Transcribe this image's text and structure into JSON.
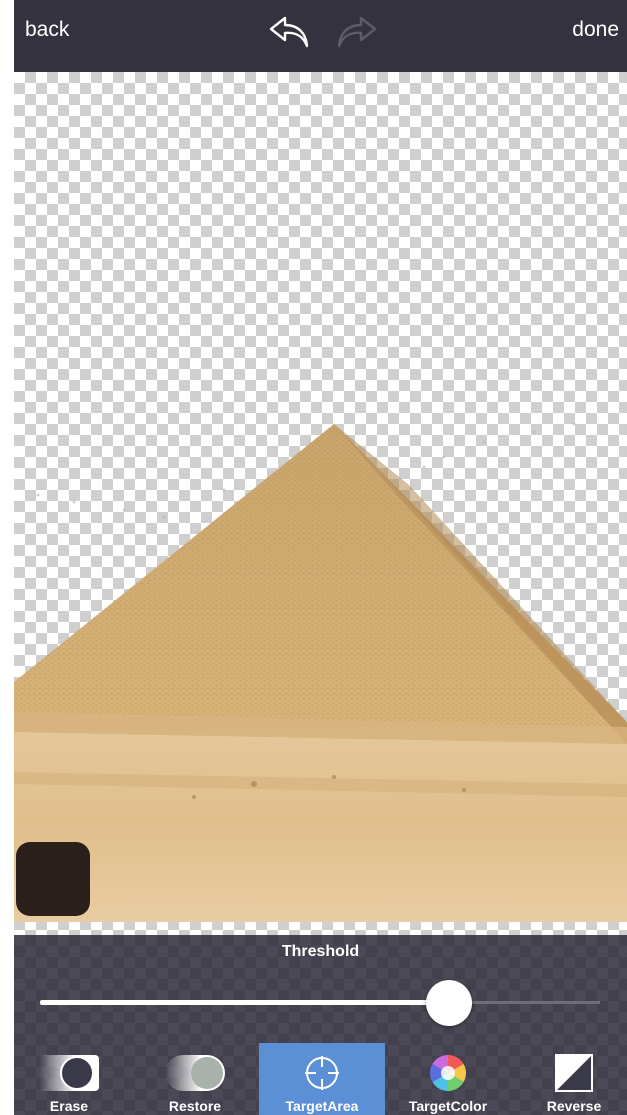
{
  "topbar": {
    "back_label": "back",
    "done_label": "done",
    "undo_icon": "undo-arrow-icon",
    "redo_icon": "redo-arrow-icon (disabled)"
  },
  "canvas": {
    "background": "transparency-checkerboard",
    "image": "pyramid-photo-cutout"
  },
  "brush": {
    "color": "#2a1f1a"
  },
  "threshold": {
    "label": "Threshold",
    "value": 0.73
  },
  "tools": [
    {
      "label": "Erase",
      "icon": "erase-icon",
      "active": false
    },
    {
      "label": "Restore",
      "icon": "restore-icon",
      "active": false
    },
    {
      "label": "TargetArea",
      "icon": "crosshair-icon",
      "active": true
    },
    {
      "label": "TargetColor",
      "icon": "color-wheel-icon",
      "active": false
    },
    {
      "label": "Reverse",
      "icon": "reverse-icon",
      "active": false
    }
  ],
  "colors": {
    "topbar": "#34323f",
    "accent": "#5b8fd6",
    "panel": "#4a4955"
  }
}
